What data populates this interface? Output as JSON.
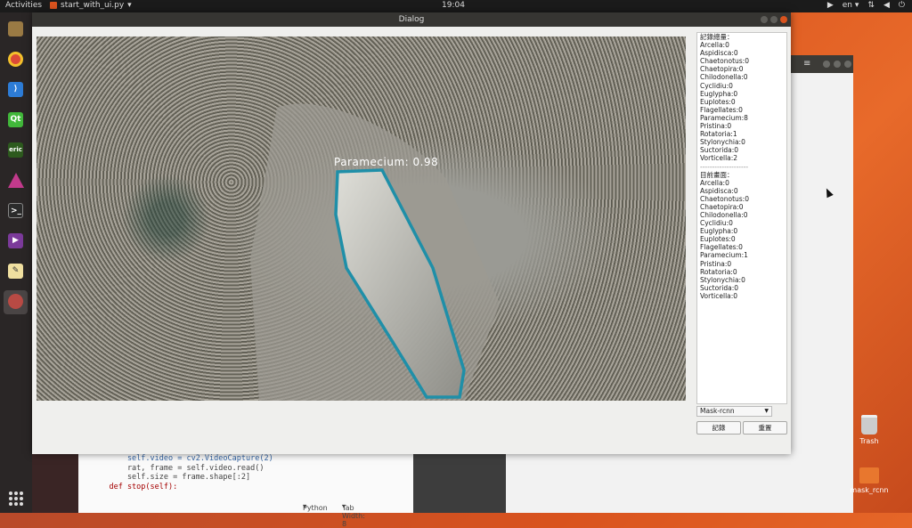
{
  "topbar": {
    "activities": "Activities",
    "app_name": "start_with_ui.py",
    "clock": "19:04",
    "lang": "en"
  },
  "dock": {
    "items": [
      {
        "name": "files",
        "color": "#8a6d3b"
      },
      {
        "name": "chrome",
        "color": "#dc4a38"
      },
      {
        "name": "vscode",
        "color": "#2d7cd6"
      },
      {
        "name": "qt-creator",
        "label": "Qt",
        "color": "#41b73a"
      },
      {
        "name": "eric",
        "label": "eric",
        "color": "#2d5a1e"
      },
      {
        "name": "prism",
        "color": "#c23a8c"
      },
      {
        "name": "terminal",
        "color": "#2b2b2b"
      },
      {
        "name": "video",
        "color": "#7b3a9a"
      },
      {
        "name": "text-editor",
        "color": "#e0c25a"
      },
      {
        "name": "dialog-app",
        "color": "#b84a44"
      }
    ]
  },
  "dialog": {
    "title": "Dialog",
    "detection_label": "Paramecium: 0.98",
    "totals_header": "記錄總量：",
    "totals": [
      "Arcella:0",
      "Aspidisca:0",
      "Chaetonotus:0",
      "Chaetopira:0",
      "Chilodonella:0",
      "Cyclidiu:0",
      "Euglypha:0",
      "Euplotes:0",
      "Flagellates:0",
      "Paramecium:8",
      "Pristina:0",
      "Rotatoria:1",
      "Stylonychia:0",
      "Suctorida:0",
      "Vorticella:2"
    ],
    "separator": "--------------------",
    "current_header": "目前畫面：",
    "current": [
      "Arcella:0",
      "Aspidisca:0",
      "Chaetonotus:0",
      "Chaetopira:0",
      "Chilodonella:0",
      "Cyclidiu:0",
      "Euglypha:0",
      "Euplotes:0",
      "Flagellates:0",
      "Paramecium:1",
      "Pristina:0",
      "Rotatoria:0",
      "Stylonychia:0",
      "Suctorida:0",
      "Vorticella:0"
    ],
    "model_select": "Mask-rcnn",
    "record_button": "記錄",
    "reset_button": "重置",
    "outline_color": "#1f8fa8"
  },
  "editor": {
    "code_lines": [
      "        self.video = cv2.VideoCapture(2)",
      "        rat, frame = self.video.read()",
      "        self.size = frame.shape[:2]",
      "",
      "    def stop(self):"
    ],
    "language": "Python",
    "tab_width": "Tab Width: 8"
  },
  "desktop": {
    "trash_label": "Trash",
    "folder_label": "mask_rcnn"
  }
}
